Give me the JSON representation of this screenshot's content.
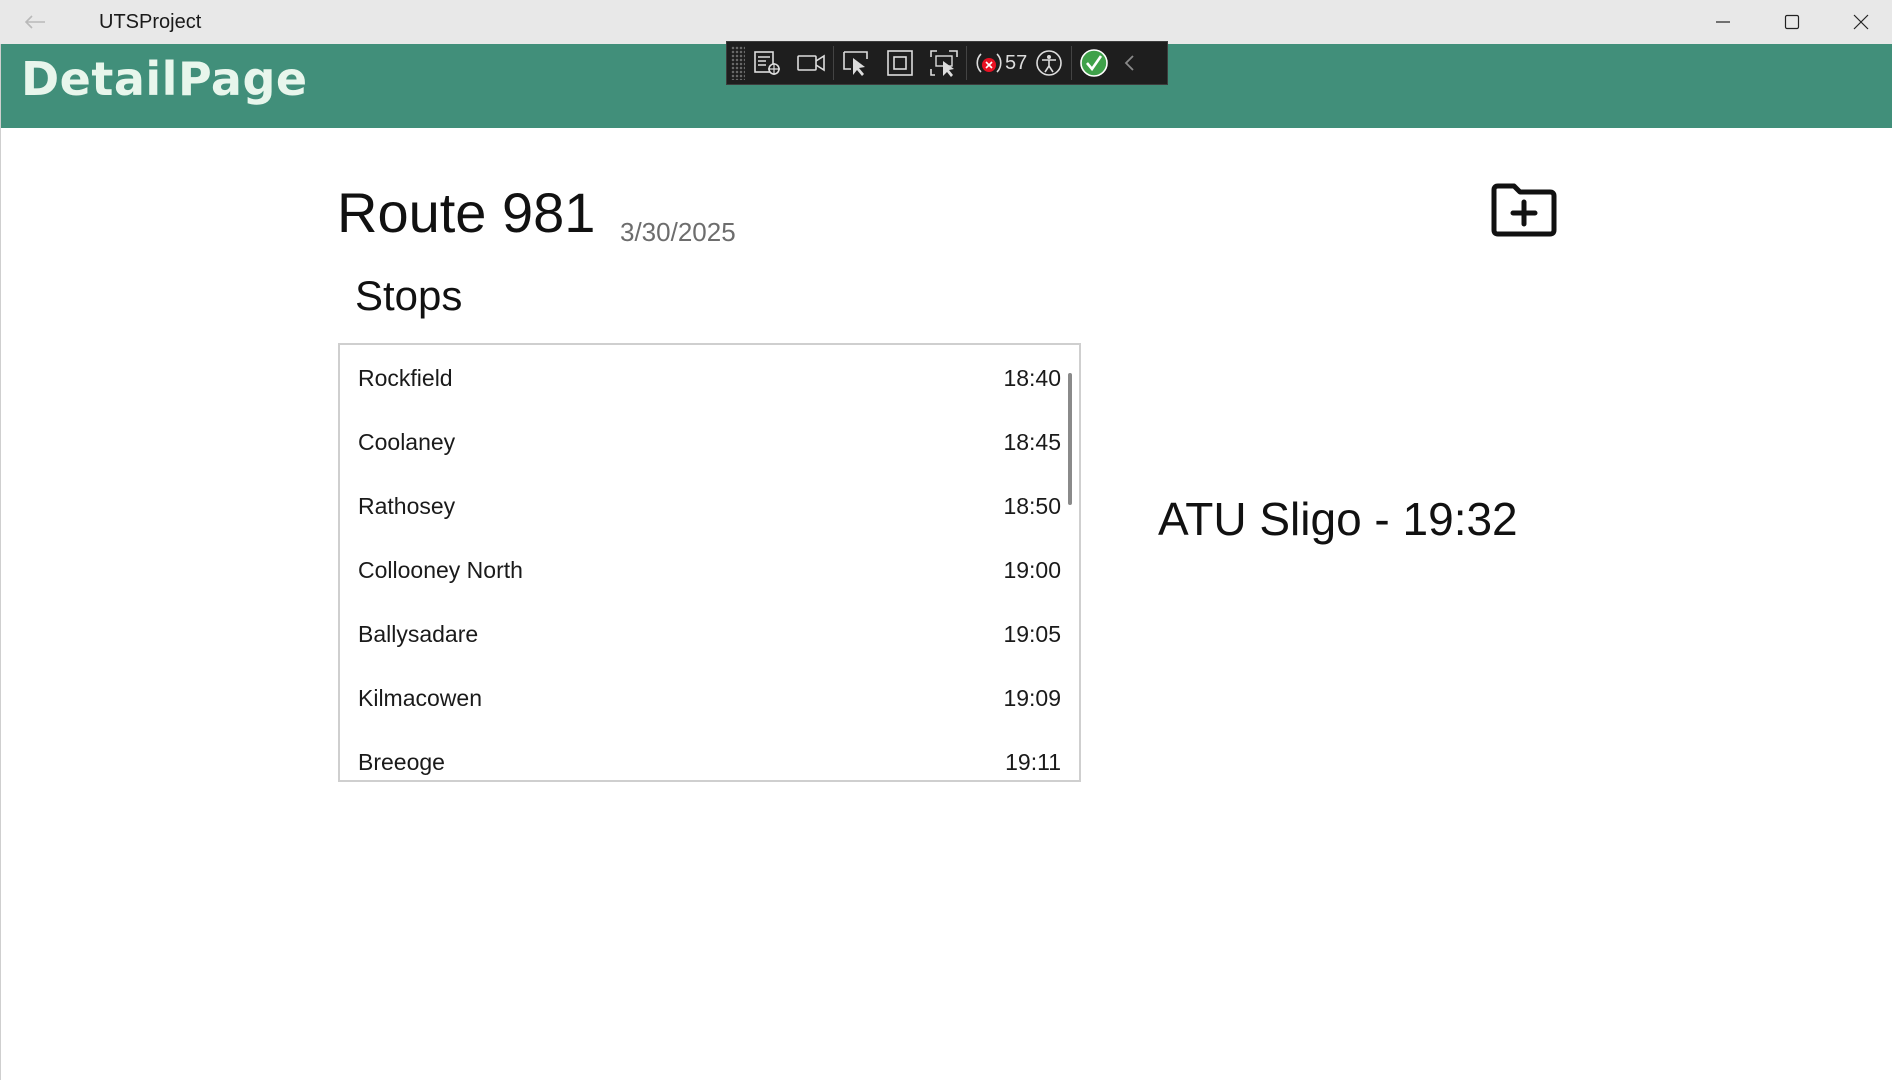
{
  "window": {
    "title": "UTSProject",
    "back_icon": "arrow-left-icon",
    "controls": [
      "minimize-icon",
      "maximize-icon",
      "close-icon"
    ]
  },
  "header": {
    "title": "DetailPage",
    "background": "#418f7a"
  },
  "debug_toolbar": {
    "icons": [
      "live-visual-tree-icon",
      "video-icon",
      "select-element-icon",
      "display-layout-adorners-icon",
      "track-focus-icon",
      "binding-failures-icon",
      "accessibility-icon",
      "hot-reload-check-icon",
      "collapse-chevron-icon"
    ],
    "binding_failures_count": "57"
  },
  "route": {
    "title": "Route 981",
    "date": "3/30/2025",
    "add_button_icon": "folder-add-icon"
  },
  "stops": {
    "heading": "Stops",
    "items": [
      {
        "name": "Rockfield",
        "time": "18:40"
      },
      {
        "name": "Coolaney",
        "time": "18:45"
      },
      {
        "name": "Rathosey",
        "time": "18:50"
      },
      {
        "name": "Collooney North",
        "time": "19:00"
      },
      {
        "name": "Ballysadare",
        "time": "19:05"
      },
      {
        "name": "Kilmacowen",
        "time": "19:09"
      },
      {
        "name": "Breeoge",
        "time": "19:11"
      }
    ]
  },
  "destination": {
    "text": "ATU Sligo - 19:32"
  }
}
